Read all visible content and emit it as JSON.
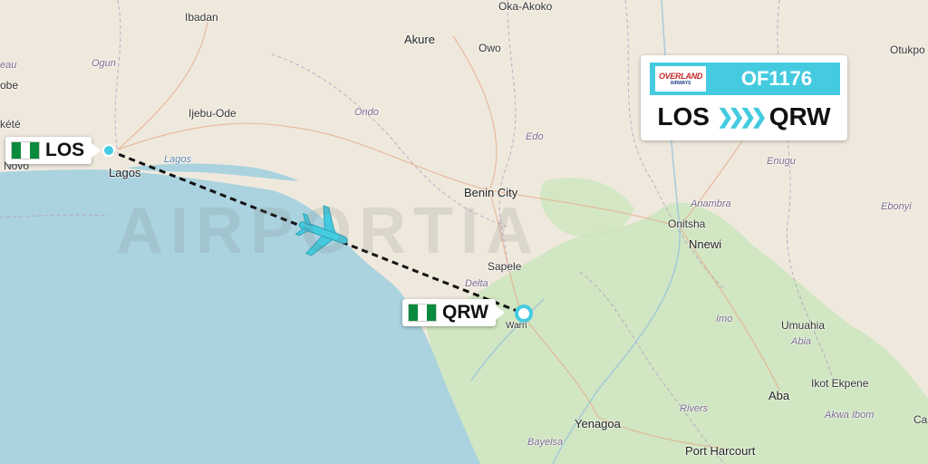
{
  "flight": {
    "number": "OF1176",
    "airline_logo": "OVERLAND",
    "airline_logo_sub": "AIRWAYS",
    "origin": "LOS",
    "destination": "QRW",
    "route_arrow_icon": "chevrons-right-icon"
  },
  "origin_tag": {
    "code": "LOS",
    "flag": "nigeria-flag-icon"
  },
  "destination_tag": {
    "code": "QRW",
    "flag": "nigeria-flag-icon"
  },
  "watermark": "AIRPORTIA",
  "places": {
    "ibadan": "Ibadan",
    "oka_akoko": "Oka-Akoko",
    "akure": "Akure",
    "owo": "Owo",
    "otukpo": "Otukpo",
    "ogun": "Ogun",
    "ijebu_ode": "Ijebu-Ode",
    "ondo": "Ondo",
    "edo": "Edo",
    "enugu": "Enugu",
    "kete": "kété",
    "novo": "Novo",
    "lagos_city": "Lagos",
    "lagos_state": "Lagos",
    "benin_city": "Benin City",
    "anambra": "Anambra",
    "onitsha": "Onitsha",
    "nnewi": "Nnewi",
    "ebonyi": "Ebonyi",
    "sapele": "Sapele",
    "delta": "Delta",
    "warri": "Warri",
    "imo": "Imo",
    "umuahia": "Umuahia",
    "abia": "Abia",
    "ikot_ekpene": "Ikot Ekpene",
    "aba": "Aba",
    "rivers": "Rivers",
    "akwa_ibom": "Akwa Ibom",
    "yenagoa": "Yenagoa",
    "bayelsa": "Bayelsa",
    "port_harcourt": "Port Harcourt",
    "eau": "eau",
    "obe": "obe",
    "cal": "Ca"
  },
  "colors": {
    "land": "#efe9dd",
    "sea": "#aad3df",
    "forest": "#cde6bf",
    "accent": "#45cbe0",
    "route_line": "#111111"
  },
  "progress_fraction": 0.5
}
